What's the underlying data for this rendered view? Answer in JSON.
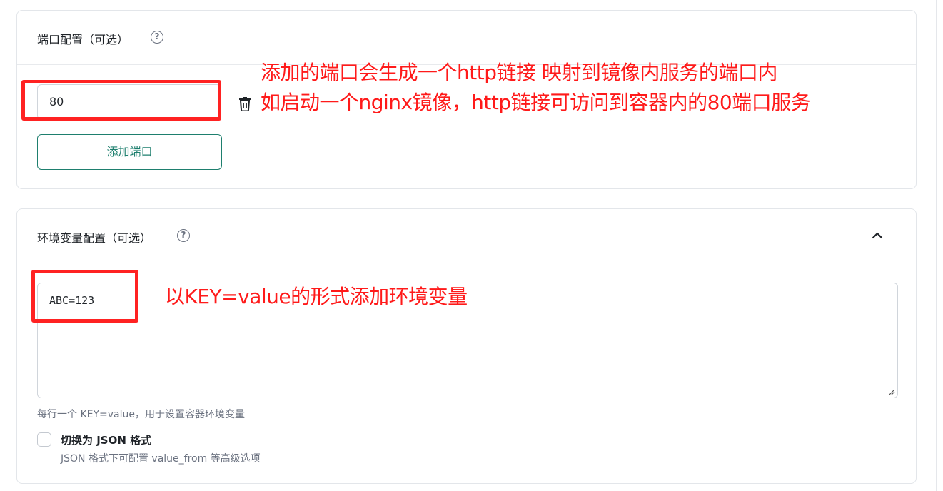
{
  "port_section": {
    "title": "端口配置（可选）",
    "help_icon": "question-circle-icon",
    "port_value": "80",
    "delete_icon": "trash-icon",
    "add_button_label": "添加端口"
  },
  "env_section": {
    "title": "环境变量配置（可选）",
    "help_icon": "question-circle-icon",
    "collapse_icon": "chevron-up-icon",
    "textarea_value": "ABC=123",
    "hint": "每行一个 KEY=value，用于设置容器环境变量",
    "json_toggle_label": "切换为 JSON 格式",
    "json_toggle_desc": "JSON 格式下可配置 value_from 等高级选项"
  },
  "annotations": {
    "port_note_line1": "添加的端口会生成一个http链接 映射到镜像内服务的端口内",
    "port_note_line2": "如启动一个nginx镜像，http链接可访问到容器内的80端口服务",
    "env_note": "以KEY=value的形式添加环境变量",
    "color": "#ff2222"
  },
  "colors": {
    "accent": "#1e7f6e",
    "border": "#e3e6ea",
    "muted_text": "#6b7280"
  }
}
